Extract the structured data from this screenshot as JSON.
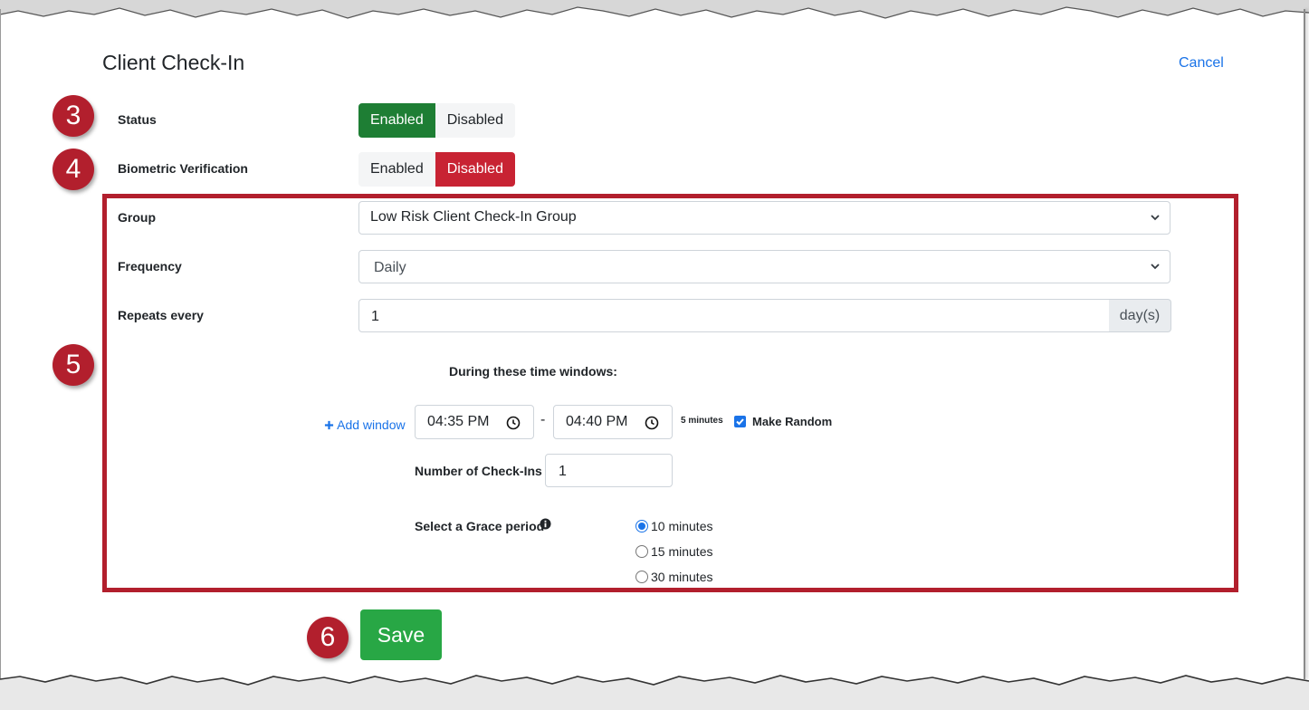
{
  "page": {
    "title": "Client Check-In",
    "cancel_label": "Cancel"
  },
  "markers": [
    "3",
    "4",
    "5",
    "6"
  ],
  "status": {
    "label": "Status",
    "options": [
      "Enabled",
      "Disabled"
    ],
    "selected": "Enabled"
  },
  "biometric": {
    "label": "Biometric Verification",
    "options": [
      "Enabled",
      "Disabled"
    ],
    "selected": "Disabled"
  },
  "group": {
    "label": "Group",
    "value": "Low Risk Client Check-In Group"
  },
  "frequency": {
    "label": "Frequency",
    "value": "Daily"
  },
  "repeats": {
    "label": "Repeats every",
    "value": "1",
    "unit": "day(s)"
  },
  "time_windows": {
    "heading": "During these time windows:",
    "add_window_label": "Add window",
    "start": "04:35 PM",
    "separator": "-",
    "end": "04:40 PM",
    "duration": "5 minutes",
    "make_random_label": "Make Random",
    "make_random_checked": true
  },
  "checkins": {
    "label": "Number of Check-Ins",
    "value": "1"
  },
  "grace": {
    "label": "Select a Grace period",
    "options": [
      "10 minutes",
      "15 minutes",
      "30 minutes"
    ],
    "selected": "10 minutes"
  },
  "save_label": "Save",
  "colors": {
    "accent_blue": "#1a73e8",
    "enabled_green": "#1e7e34",
    "disabled_red": "#c82333",
    "marker_red": "#b21f2d",
    "save_green": "#28a745"
  }
}
